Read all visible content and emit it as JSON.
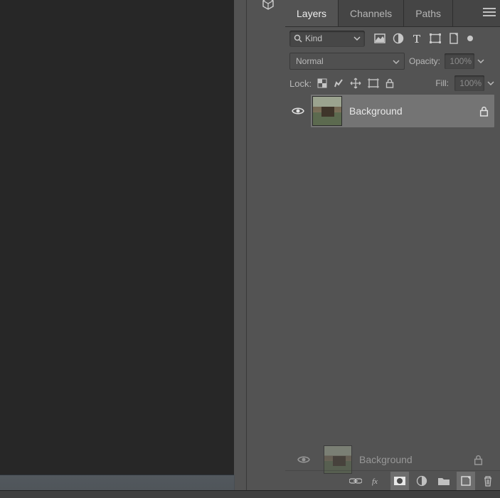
{
  "tabs": {
    "layers": "Layers",
    "channels": "Channels",
    "paths": "Paths"
  },
  "filter": {
    "kind_label": "Kind"
  },
  "blend": {
    "mode": "Normal",
    "opacity_label": "Opacity:",
    "opacity_value": "100%",
    "fill_label": "Fill:",
    "fill_value": "100%"
  },
  "lock": {
    "label": "Lock:"
  },
  "layers": [
    {
      "name": "Background",
      "locked": true,
      "visible": true,
      "selected": true
    }
  ],
  "drag_ghost": {
    "name": "Background"
  },
  "icons": {
    "prism": "prism-icon",
    "menu": "menu-icon",
    "search": "search-icon"
  }
}
